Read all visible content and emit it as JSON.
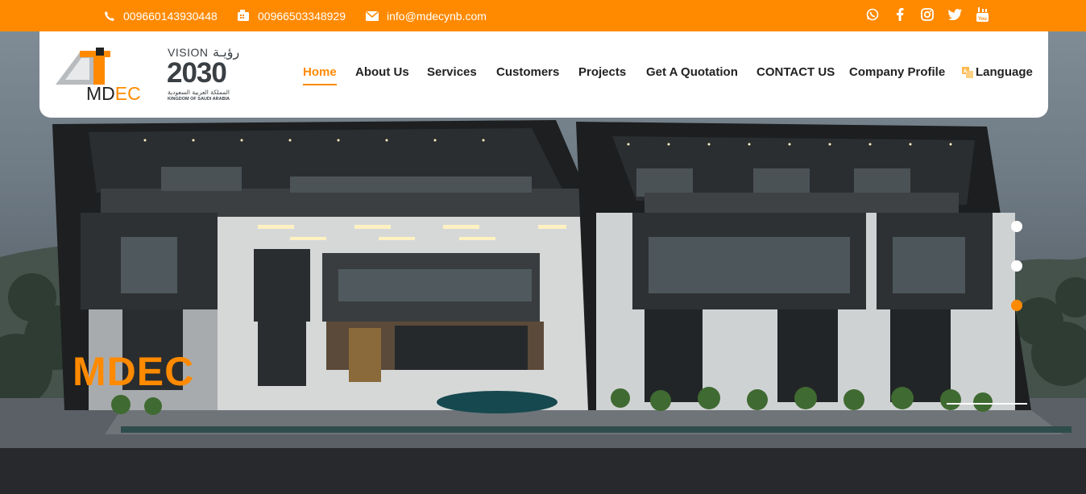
{
  "topbar": {
    "phone1": "009660143930448",
    "phone2": "00966503348929",
    "email": "info@mdecynb.com",
    "social_icons": [
      "whatsapp-icon",
      "facebook-icon",
      "instagram-icon",
      "twitter-icon",
      "youtube-icon"
    ]
  },
  "brand": {
    "logo_text_md": "MD",
    "logo_text_ec": "EC",
    "vision_label": "VISION",
    "vision_year": "2030",
    "vision_arabic_title": "رؤيـة",
    "vision_arabic_sub": "المملكة العربية السعودية",
    "vision_english_sub": "KINGDOM OF SAUDI ARABIA"
  },
  "nav": {
    "items": [
      {
        "label": "Home",
        "active": true
      },
      {
        "label": "About Us"
      },
      {
        "label": "Services"
      },
      {
        "label": "Customers"
      },
      {
        "label": "Projects"
      },
      {
        "label": "Get A Quotation"
      },
      {
        "label": "CONTACT US"
      },
      {
        "label": "Company Profile"
      }
    ],
    "language_label": "Language"
  },
  "hero": {
    "title": "MDEC",
    "active_slide": 3,
    "slide_count": 3
  },
  "colors": {
    "accent": "#ff8a00",
    "text": "#222222",
    "white": "#ffffff"
  }
}
